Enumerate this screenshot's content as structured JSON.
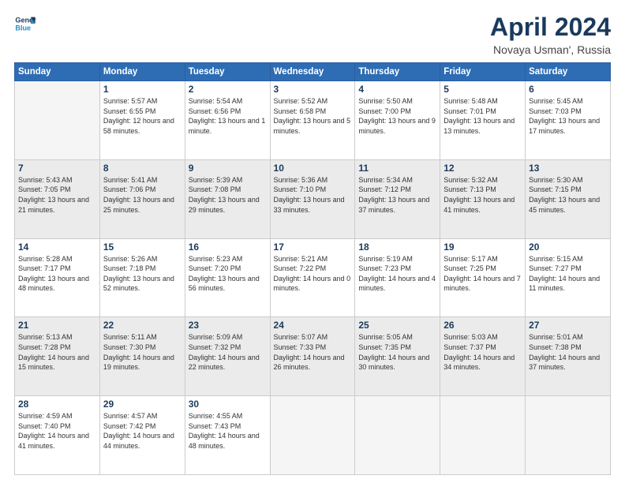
{
  "header": {
    "logo_line1": "General",
    "logo_line2": "Blue",
    "month": "April 2024",
    "location": "Novaya Usman', Russia"
  },
  "days_of_week": [
    "Sunday",
    "Monday",
    "Tuesday",
    "Wednesday",
    "Thursday",
    "Friday",
    "Saturday"
  ],
  "weeks": [
    [
      {
        "day": "",
        "empty": true
      },
      {
        "day": "1",
        "sunrise": "5:57 AM",
        "sunset": "6:55 PM",
        "daylight": "12 hours and 58 minutes."
      },
      {
        "day": "2",
        "sunrise": "5:54 AM",
        "sunset": "6:56 PM",
        "daylight": "13 hours and 1 minute."
      },
      {
        "day": "3",
        "sunrise": "5:52 AM",
        "sunset": "6:58 PM",
        "daylight": "13 hours and 5 minutes."
      },
      {
        "day": "4",
        "sunrise": "5:50 AM",
        "sunset": "7:00 PM",
        "daylight": "13 hours and 9 minutes."
      },
      {
        "day": "5",
        "sunrise": "5:48 AM",
        "sunset": "7:01 PM",
        "daylight": "13 hours and 13 minutes."
      },
      {
        "day": "6",
        "sunrise": "5:45 AM",
        "sunset": "7:03 PM",
        "daylight": "13 hours and 17 minutes."
      }
    ],
    [
      {
        "day": "7",
        "sunrise": "5:43 AM",
        "sunset": "7:05 PM",
        "daylight": "13 hours and 21 minutes."
      },
      {
        "day": "8",
        "sunrise": "5:41 AM",
        "sunset": "7:06 PM",
        "daylight": "13 hours and 25 minutes."
      },
      {
        "day": "9",
        "sunrise": "5:39 AM",
        "sunset": "7:08 PM",
        "daylight": "13 hours and 29 minutes."
      },
      {
        "day": "10",
        "sunrise": "5:36 AM",
        "sunset": "7:10 PM",
        "daylight": "13 hours and 33 minutes."
      },
      {
        "day": "11",
        "sunrise": "5:34 AM",
        "sunset": "7:12 PM",
        "daylight": "13 hours and 37 minutes."
      },
      {
        "day": "12",
        "sunrise": "5:32 AM",
        "sunset": "7:13 PM",
        "daylight": "13 hours and 41 minutes."
      },
      {
        "day": "13",
        "sunrise": "5:30 AM",
        "sunset": "7:15 PM",
        "daylight": "13 hours and 45 minutes."
      }
    ],
    [
      {
        "day": "14",
        "sunrise": "5:28 AM",
        "sunset": "7:17 PM",
        "daylight": "13 hours and 48 minutes."
      },
      {
        "day": "15",
        "sunrise": "5:26 AM",
        "sunset": "7:18 PM",
        "daylight": "13 hours and 52 minutes."
      },
      {
        "day": "16",
        "sunrise": "5:23 AM",
        "sunset": "7:20 PM",
        "daylight": "13 hours and 56 minutes."
      },
      {
        "day": "17",
        "sunrise": "5:21 AM",
        "sunset": "7:22 PM",
        "daylight": "14 hours and 0 minutes."
      },
      {
        "day": "18",
        "sunrise": "5:19 AM",
        "sunset": "7:23 PM",
        "daylight": "14 hours and 4 minutes."
      },
      {
        "day": "19",
        "sunrise": "5:17 AM",
        "sunset": "7:25 PM",
        "daylight": "14 hours and 7 minutes."
      },
      {
        "day": "20",
        "sunrise": "5:15 AM",
        "sunset": "7:27 PM",
        "daylight": "14 hours and 11 minutes."
      }
    ],
    [
      {
        "day": "21",
        "sunrise": "5:13 AM",
        "sunset": "7:28 PM",
        "daylight": "14 hours and 15 minutes."
      },
      {
        "day": "22",
        "sunrise": "5:11 AM",
        "sunset": "7:30 PM",
        "daylight": "14 hours and 19 minutes."
      },
      {
        "day": "23",
        "sunrise": "5:09 AM",
        "sunset": "7:32 PM",
        "daylight": "14 hours and 22 minutes."
      },
      {
        "day": "24",
        "sunrise": "5:07 AM",
        "sunset": "7:33 PM",
        "daylight": "14 hours and 26 minutes."
      },
      {
        "day": "25",
        "sunrise": "5:05 AM",
        "sunset": "7:35 PM",
        "daylight": "14 hours and 30 minutes."
      },
      {
        "day": "26",
        "sunrise": "5:03 AM",
        "sunset": "7:37 PM",
        "daylight": "14 hours and 34 minutes."
      },
      {
        "day": "27",
        "sunrise": "5:01 AM",
        "sunset": "7:38 PM",
        "daylight": "14 hours and 37 minutes."
      }
    ],
    [
      {
        "day": "28",
        "sunrise": "4:59 AM",
        "sunset": "7:40 PM",
        "daylight": "14 hours and 41 minutes."
      },
      {
        "day": "29",
        "sunrise": "4:57 AM",
        "sunset": "7:42 PM",
        "daylight": "14 hours and 44 minutes."
      },
      {
        "day": "30",
        "sunrise": "4:55 AM",
        "sunset": "7:43 PM",
        "daylight": "14 hours and 48 minutes."
      },
      {
        "day": "",
        "empty": true
      },
      {
        "day": "",
        "empty": true
      },
      {
        "day": "",
        "empty": true
      },
      {
        "day": "",
        "empty": true
      }
    ]
  ]
}
